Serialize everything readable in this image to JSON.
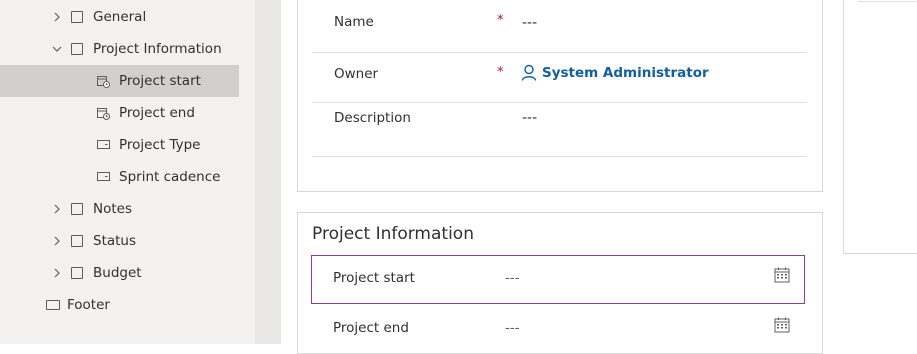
{
  "tree": {
    "items": [
      {
        "label": "General",
        "chevron": "right",
        "icon": "square"
      },
      {
        "label": "Project Information",
        "chevron": "down",
        "icon": "square"
      },
      {
        "label": "Project start",
        "icon": "date-field"
      },
      {
        "label": "Project end",
        "icon": "date-field"
      },
      {
        "label": "Project Type",
        "icon": "choice-field"
      },
      {
        "label": "Sprint cadence",
        "icon": "choice-field"
      },
      {
        "label": "Notes",
        "chevron": "right",
        "icon": "square"
      },
      {
        "label": "Status",
        "chevron": "right",
        "icon": "square"
      },
      {
        "label": "Budget",
        "chevron": "right",
        "icon": "square"
      },
      {
        "label": "Footer",
        "icon": "square"
      }
    ],
    "selected": "Project start"
  },
  "general_section": {
    "fields": [
      {
        "label": "Name",
        "required": "*",
        "value": "---"
      },
      {
        "label": "Owner",
        "required": "*",
        "value": "System Administrator",
        "icon": "person-icon"
      },
      {
        "label": "Description",
        "value": "---"
      }
    ]
  },
  "project_section": {
    "title": "Project Information",
    "fields": [
      {
        "label": "Project start",
        "value": "---",
        "icon": "calendar-icon"
      },
      {
        "label": "Project end",
        "value": "---",
        "icon": "calendar-icon"
      }
    ]
  },
  "colors": {
    "selected_row": "#d2d0ce",
    "focus_border": "#8a3f9e",
    "required": "#c50f1f",
    "link": "#115ea3"
  }
}
